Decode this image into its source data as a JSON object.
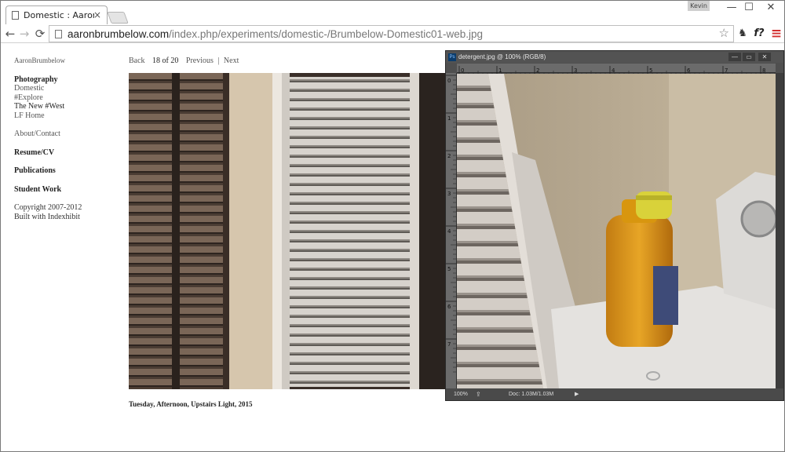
{
  "browser": {
    "tab_title": "Domestic : AaronBrumbelow",
    "tab_close": "×",
    "user_name": "Kevin",
    "window_controls": {
      "minimize": "—",
      "maximize": "☐",
      "close": "✕"
    },
    "nav": {
      "back": "←",
      "forward": "→",
      "reload": "⟳"
    },
    "url_host": "aaronbrumbelow.com",
    "url_path": "/index.php/experiments/domestic-/Brumbelow-Domestic01-web.jpg",
    "star": "☆",
    "extensions": {
      "ext1": "♞",
      "ext2": "f?",
      "menu": "≡"
    }
  },
  "site": {
    "name": "AaronBrumbelow",
    "photography": {
      "heading": "Photography",
      "items": [
        "Domestic",
        "#Explore",
        "The New #West",
        "LF Home"
      ]
    },
    "about": "About/Contact",
    "resume": "Resume/CV",
    "publications": "Publications",
    "student_work": "Student Work",
    "copyright": "Copyright 2007-2012",
    "built_with": "Built with Indexhibit"
  },
  "pager": {
    "back": "Back",
    "position": "18 of 20",
    "previous": "Previous",
    "separator": "|",
    "next": "Next"
  },
  "caption": "Tuesday, Afternoon, Upstairs Light, 2015",
  "photoshop": {
    "logo": "Ps",
    "title": "detergent.jpg @ 100% (RGB/8)",
    "buttons": {
      "minimize": "—",
      "maximize": "▭",
      "close": "✕"
    },
    "ruler_top_labels": [
      "0",
      "1",
      "2",
      "3",
      "4",
      "5",
      "6",
      "7",
      "8"
    ],
    "ruler_left_labels": [
      "0",
      "1",
      "2",
      "3",
      "4",
      "5",
      "6",
      "7"
    ],
    "zoom": "100%",
    "doc_info": "Doc: 1.03M/1.03M",
    "play": "▶"
  },
  "colors": {
    "link_gray": "#555555",
    "ps_frame": "#4f4f4f",
    "chrome_red_menu": "#d32f2f"
  }
}
